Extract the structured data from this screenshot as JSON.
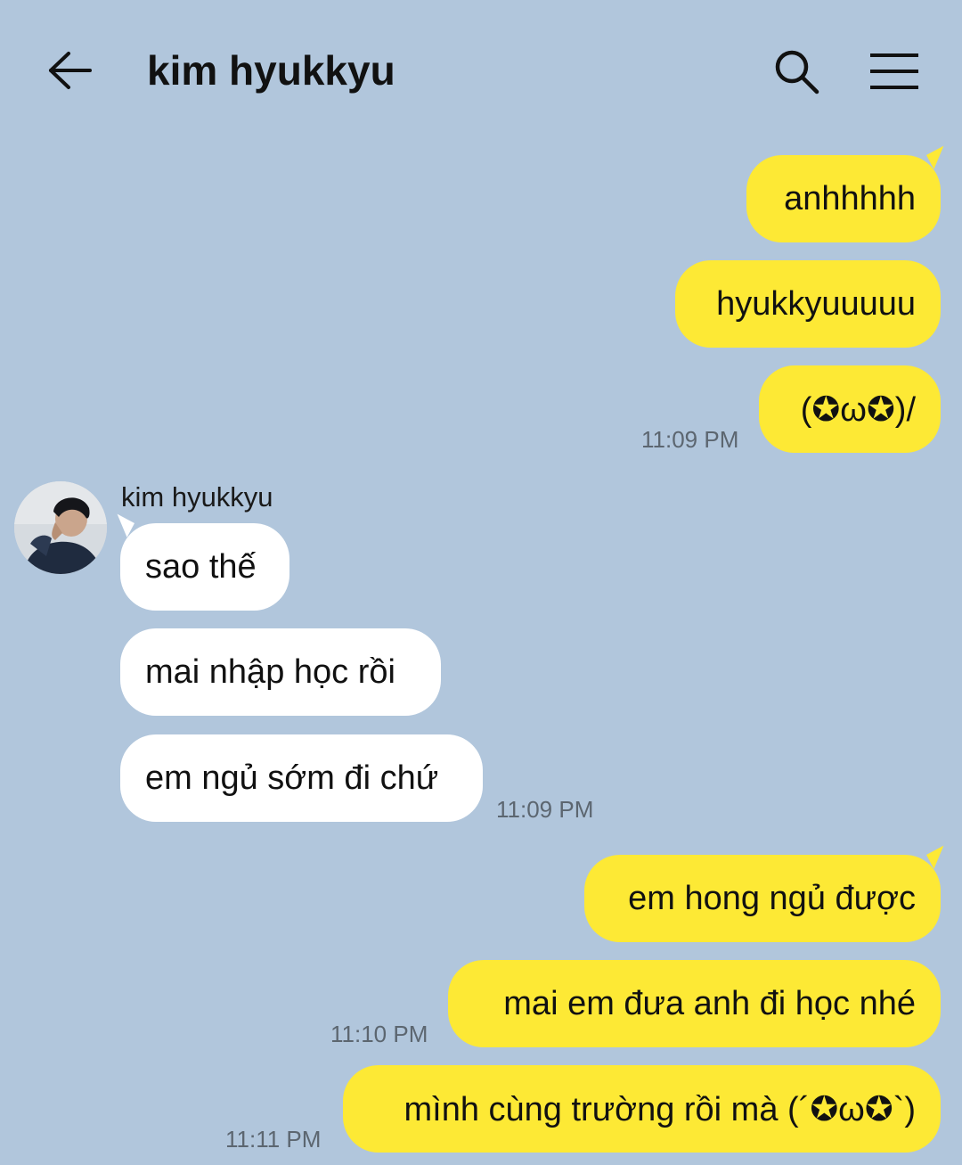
{
  "header": {
    "title": "kim hyukkyu",
    "back_icon": "arrow-left-icon",
    "search_icon": "search-icon",
    "menu_icon": "hamburger-menu-icon"
  },
  "colors": {
    "background": "#b1c6dc",
    "outgoing_bubble": "#fde935",
    "incoming_bubble": "#ffffff"
  },
  "messages": [
    {
      "direction": "outgoing",
      "text": "anhhhhh"
    },
    {
      "direction": "outgoing",
      "text": "hyukkyuuuuu"
    },
    {
      "direction": "outgoing",
      "text": "(✪ω✪)/",
      "time": "11:09 PM"
    },
    {
      "direction": "incoming",
      "sender": "kim hyukkyu",
      "text": "sao thế"
    },
    {
      "direction": "incoming",
      "text": "mai nhập học rồi"
    },
    {
      "direction": "incoming",
      "text": "em ngủ sớm đi chứ",
      "time": "11:09 PM"
    },
    {
      "direction": "outgoing",
      "text": "em hong ngủ được"
    },
    {
      "direction": "outgoing",
      "text": "mai em đưa anh đi học nhé",
      "time": "11:10 PM"
    },
    {
      "direction": "outgoing",
      "text": "mình cùng trường rồi mà (´✪ω✪`)",
      "time": "11:11 PM"
    }
  ]
}
